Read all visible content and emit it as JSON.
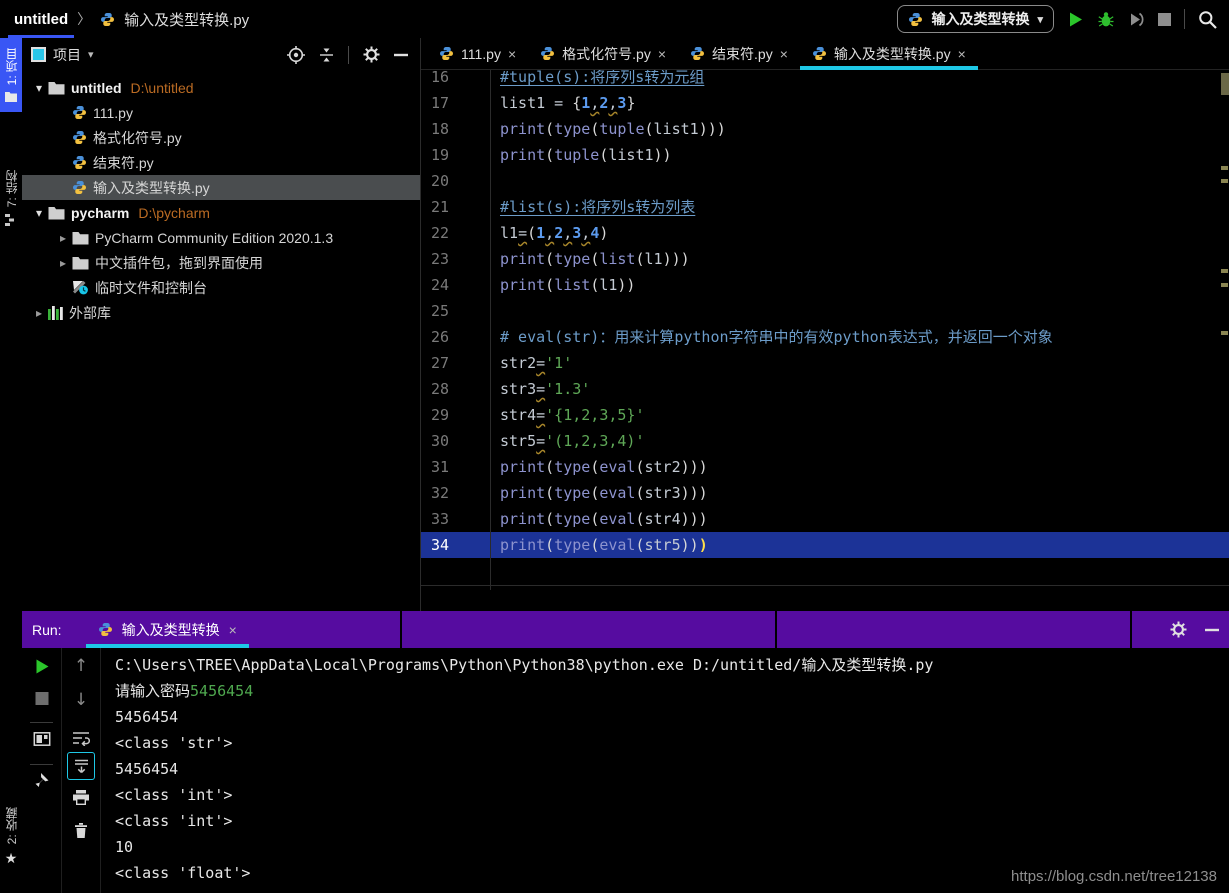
{
  "window": {
    "project_name": "untitled",
    "separator": "〉",
    "file_name": "输入及类型转换.py"
  },
  "toolbar": {
    "run_config": "输入及类型转换"
  },
  "left_strip": {
    "project": "1: 项目",
    "structure": "7: 结构",
    "favorites": "2: 收藏"
  },
  "project_panel": {
    "title": "项目",
    "tree": [
      {
        "level": 0,
        "arrow": "down",
        "icon": "folder",
        "label": "untitled",
        "path": "D:\\untitled",
        "bold": true
      },
      {
        "level": 1,
        "icon": "python",
        "label": "111.py"
      },
      {
        "level": 1,
        "icon": "python",
        "label": "格式化符号.py"
      },
      {
        "level": 1,
        "icon": "python",
        "label": "结束符.py"
      },
      {
        "level": 1,
        "icon": "python",
        "label": "输入及类型转换.py",
        "selected": true
      },
      {
        "level": 0,
        "arrow": "down",
        "icon": "folder",
        "label": "pycharm",
        "path": "D:\\pycharm",
        "bold": true
      },
      {
        "level": 1,
        "arrow": "right",
        "icon": "folder",
        "label": "PyCharm Community Edition 2020.1.3"
      },
      {
        "level": 1,
        "arrow": "right",
        "icon": "folder",
        "label": "中文插件包，拖到界面使用"
      },
      {
        "level": 1,
        "icon": "scratch",
        "label": "临时文件和控制台"
      },
      {
        "level": 0,
        "arrow": "right",
        "icon": "library",
        "label": "外部库"
      }
    ]
  },
  "editor": {
    "tabs": [
      {
        "label": "111.py"
      },
      {
        "label": "格式化符号.py"
      },
      {
        "label": "结束符.py"
      },
      {
        "label": "输入及类型转换.py",
        "active": true
      }
    ],
    "lines": [
      {
        "n": "16",
        "seg": [
          [
            "cmtu",
            "#tuple(s):将序列s转为元组"
          ]
        ]
      },
      {
        "n": "17",
        "seg": [
          [
            "def",
            "list1 = "
          ],
          [
            "par",
            "{"
          ],
          [
            "num",
            "1"
          ],
          [
            "warn",
            ","
          ],
          [
            "num",
            "2"
          ],
          [
            "warn",
            ","
          ],
          [
            "num",
            "3"
          ],
          [
            "par",
            "}"
          ]
        ]
      },
      {
        "n": "18",
        "seg": [
          [
            "fn",
            "print"
          ],
          [
            "par",
            "("
          ],
          [
            "fn",
            "type"
          ],
          [
            "par",
            "("
          ],
          [
            "fn",
            "tuple"
          ],
          [
            "par",
            "("
          ],
          [
            "def",
            "list1"
          ],
          [
            "par",
            ")))"
          ]
        ]
      },
      {
        "n": "19",
        "seg": [
          [
            "fn",
            "print"
          ],
          [
            "par",
            "("
          ],
          [
            "fn",
            "tuple"
          ],
          [
            "par",
            "("
          ],
          [
            "def",
            "list1"
          ],
          [
            "par",
            "))"
          ]
        ]
      },
      {
        "n": "20",
        "seg": []
      },
      {
        "n": "21",
        "seg": [
          [
            "cmtu",
            "#list(s):将序列s转为列表"
          ]
        ]
      },
      {
        "n": "22",
        "seg": [
          [
            "def",
            "l1"
          ],
          [
            "warn",
            "="
          ],
          [
            "par",
            "("
          ],
          [
            "num",
            "1"
          ],
          [
            "warn",
            ","
          ],
          [
            "num",
            "2"
          ],
          [
            "warn",
            ","
          ],
          [
            "num",
            "3"
          ],
          [
            "warn",
            ","
          ],
          [
            "num",
            "4"
          ],
          [
            "par",
            ")"
          ]
        ]
      },
      {
        "n": "23",
        "seg": [
          [
            "fn",
            "print"
          ],
          [
            "par",
            "("
          ],
          [
            "fn",
            "type"
          ],
          [
            "par",
            "("
          ],
          [
            "fn",
            "list"
          ],
          [
            "par",
            "("
          ],
          [
            "def",
            "l1"
          ],
          [
            "par",
            ")))"
          ]
        ]
      },
      {
        "n": "24",
        "seg": [
          [
            "fn",
            "print"
          ],
          [
            "par",
            "("
          ],
          [
            "fn",
            "list"
          ],
          [
            "par",
            "("
          ],
          [
            "def",
            "l1"
          ],
          [
            "par",
            "))"
          ]
        ]
      },
      {
        "n": "25",
        "seg": []
      },
      {
        "n": "26",
        "seg": [
          [
            "cmt",
            "# eval(str)：用来计算python字符串中的有效python表达式，并返回一个对象"
          ]
        ]
      },
      {
        "n": "27",
        "seg": [
          [
            "def",
            "str2"
          ],
          [
            "warn",
            "="
          ],
          [
            "str",
            "'1'"
          ]
        ]
      },
      {
        "n": "28",
        "seg": [
          [
            "def",
            "str3"
          ],
          [
            "warn",
            "="
          ],
          [
            "str",
            "'1.3'"
          ]
        ]
      },
      {
        "n": "29",
        "seg": [
          [
            "def",
            "str4"
          ],
          [
            "warn",
            "="
          ],
          [
            "str",
            "'{1,2,3,5}'"
          ]
        ]
      },
      {
        "n": "30",
        "seg": [
          [
            "def",
            "str5"
          ],
          [
            "warn",
            "="
          ],
          [
            "str",
            "'(1,2,3,4)'"
          ]
        ]
      },
      {
        "n": "31",
        "seg": [
          [
            "fn",
            "print"
          ],
          [
            "par",
            "("
          ],
          [
            "fn",
            "type"
          ],
          [
            "par",
            "("
          ],
          [
            "fn",
            "eval"
          ],
          [
            "par",
            "("
          ],
          [
            "def",
            "str2"
          ],
          [
            "par",
            ")))"
          ]
        ]
      },
      {
        "n": "32",
        "seg": [
          [
            "fn",
            "print"
          ],
          [
            "par",
            "("
          ],
          [
            "fn",
            "type"
          ],
          [
            "par",
            "("
          ],
          [
            "fn",
            "eval"
          ],
          [
            "par",
            "("
          ],
          [
            "def",
            "str3"
          ],
          [
            "par",
            ")))"
          ]
        ]
      },
      {
        "n": "33",
        "seg": [
          [
            "fn",
            "print"
          ],
          [
            "par",
            "("
          ],
          [
            "fn",
            "type"
          ],
          [
            "par",
            "("
          ],
          [
            "fn",
            "eval"
          ],
          [
            "par",
            "("
          ],
          [
            "def",
            "str4"
          ],
          [
            "par",
            ")))"
          ]
        ]
      },
      {
        "n": "34",
        "current": true,
        "seg": [
          [
            "fn",
            "print"
          ],
          [
            "par",
            "("
          ],
          [
            "fn",
            "type"
          ],
          [
            "par",
            "("
          ],
          [
            "fn",
            "eval"
          ],
          [
            "par",
            "("
          ],
          [
            "def",
            "str5"
          ],
          [
            "par",
            "))"
          ],
          [
            "hlp",
            ")"
          ]
        ]
      }
    ]
  },
  "run_panel": {
    "label": "Run:",
    "tab": "输入及类型转换",
    "console": [
      [
        [
          "w",
          "C:\\Users\\TREE\\AppData\\Local\\Programs\\Python\\Python38\\python.exe D:/untitled/输入及类型转换.py"
        ]
      ],
      [
        [
          "w",
          "请输入密码"
        ],
        [
          "g",
          "5456454"
        ]
      ],
      [
        [
          "w",
          "5456454"
        ]
      ],
      [
        [
          "w",
          "<class 'str'>"
        ]
      ],
      [
        [
          "w",
          "5456454"
        ]
      ],
      [
        [
          "w",
          "<class 'int'>"
        ]
      ],
      [
        [
          "w",
          "<class 'int'>"
        ]
      ],
      [
        [
          "w",
          "10"
        ]
      ],
      [
        [
          "w",
          "<class 'float'>"
        ]
      ]
    ],
    "watermark": "https://blog.csdn.net/tree12138"
  },
  "colors": {
    "accent_cyan": "#1EC8E6",
    "run_header_purple": "#560CA0",
    "strip_active_blue": "#3956F5",
    "current_line_blue": "#1C3397",
    "console_input_green": "#4FA84F",
    "path_orange": "#BB6B23"
  }
}
